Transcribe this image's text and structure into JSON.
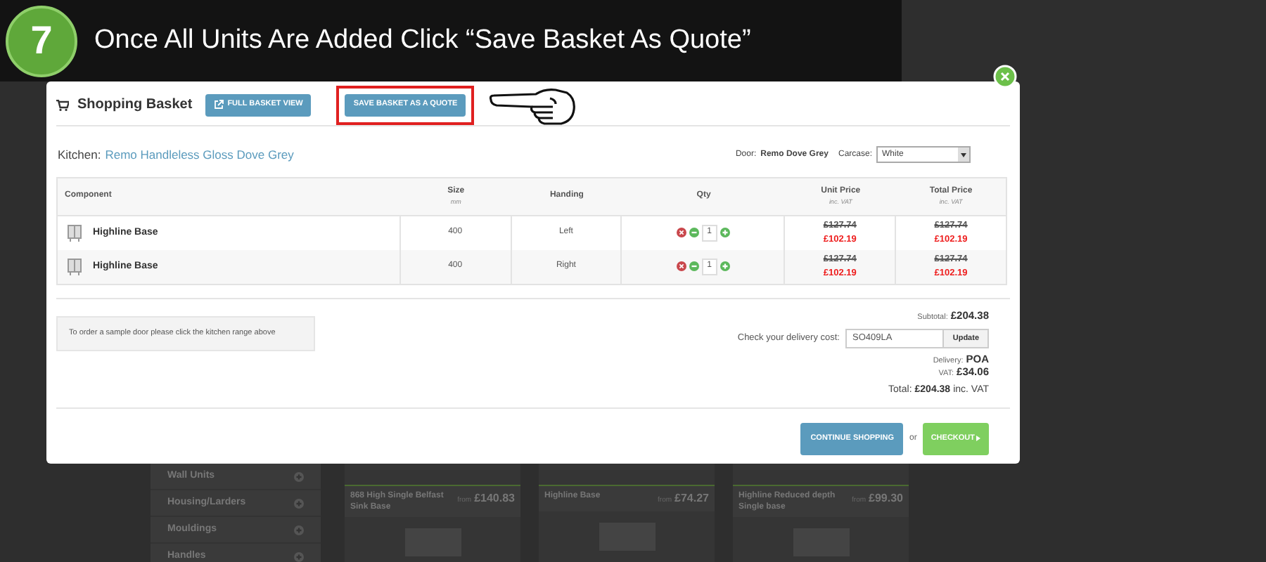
{
  "step": {
    "number": "7",
    "title": "Once All Units Are Added Click “Save Basket As Quote”"
  },
  "basket": {
    "title": "Shopping Basket",
    "buttons": [
      {
        "label": "FULL BASKET VIEW",
        "highlighted": false
      },
      {
        "label": "SAVE BASKET AS A QUOTE",
        "highlighted": true
      }
    ],
    "kitchen_label": "Kitchen:",
    "kitchen_link": "Remo Handleless Gloss Dove Grey",
    "door_label": "Door:",
    "door_value": "Remo Dove Grey",
    "carcase_label": "Carcase:",
    "carcase_value": "White",
    "table": {
      "columns": [
        {
          "label": "Component"
        },
        {
          "label": "Size",
          "sub": "mm"
        },
        {
          "label": "Handing"
        },
        {
          "label": "Qty"
        },
        {
          "label": "Unit Price",
          "sub": "inc. VAT"
        },
        {
          "label": "Total Price",
          "sub": "inc. VAT"
        }
      ],
      "rows": [
        {
          "component": "Highline Base",
          "size": "400",
          "handing": "Left",
          "qty": "1",
          "unit_was": "£127.74",
          "unit_now": "£102.19",
          "total_was": "£127.74",
          "total_now": "£102.19"
        },
        {
          "component": "Highline Base",
          "size": "400",
          "handing": "Right",
          "qty": "1",
          "unit_was": "£127.74",
          "unit_now": "£102.19",
          "total_was": "£127.74",
          "total_now": "£102.19"
        }
      ]
    },
    "sample_note": "To order a sample door please click the kitchen range above",
    "subtotal_label": "Subtotal:",
    "subtotal": "£204.38",
    "delivery_check_label": "Check your delivery cost:",
    "postcode": "SO409LA",
    "update": "Update",
    "delivery_label": "Delivery:",
    "delivery": "POA",
    "vat_label": "VAT:",
    "vat": "£34.06",
    "total_label": "Total:",
    "total": "£204.38",
    "total_suffix": "inc. VAT",
    "continue": "CONTINUE SHOPPING",
    "or": "or",
    "checkout": "CHECKOUT"
  },
  "background": {
    "sidebar": [
      "Wall Units",
      "Housing/Larders",
      "Mouldings",
      "Handles"
    ],
    "products": [
      {
        "name": "868 High Single Belfast Sink Base",
        "from": "from",
        "price": "£140.83"
      },
      {
        "name": "Highline Base",
        "from": "from",
        "price": "£74.27"
      },
      {
        "name": "Highline Reduced depth Single base",
        "from": "from",
        "price": "£99.30"
      }
    ]
  }
}
